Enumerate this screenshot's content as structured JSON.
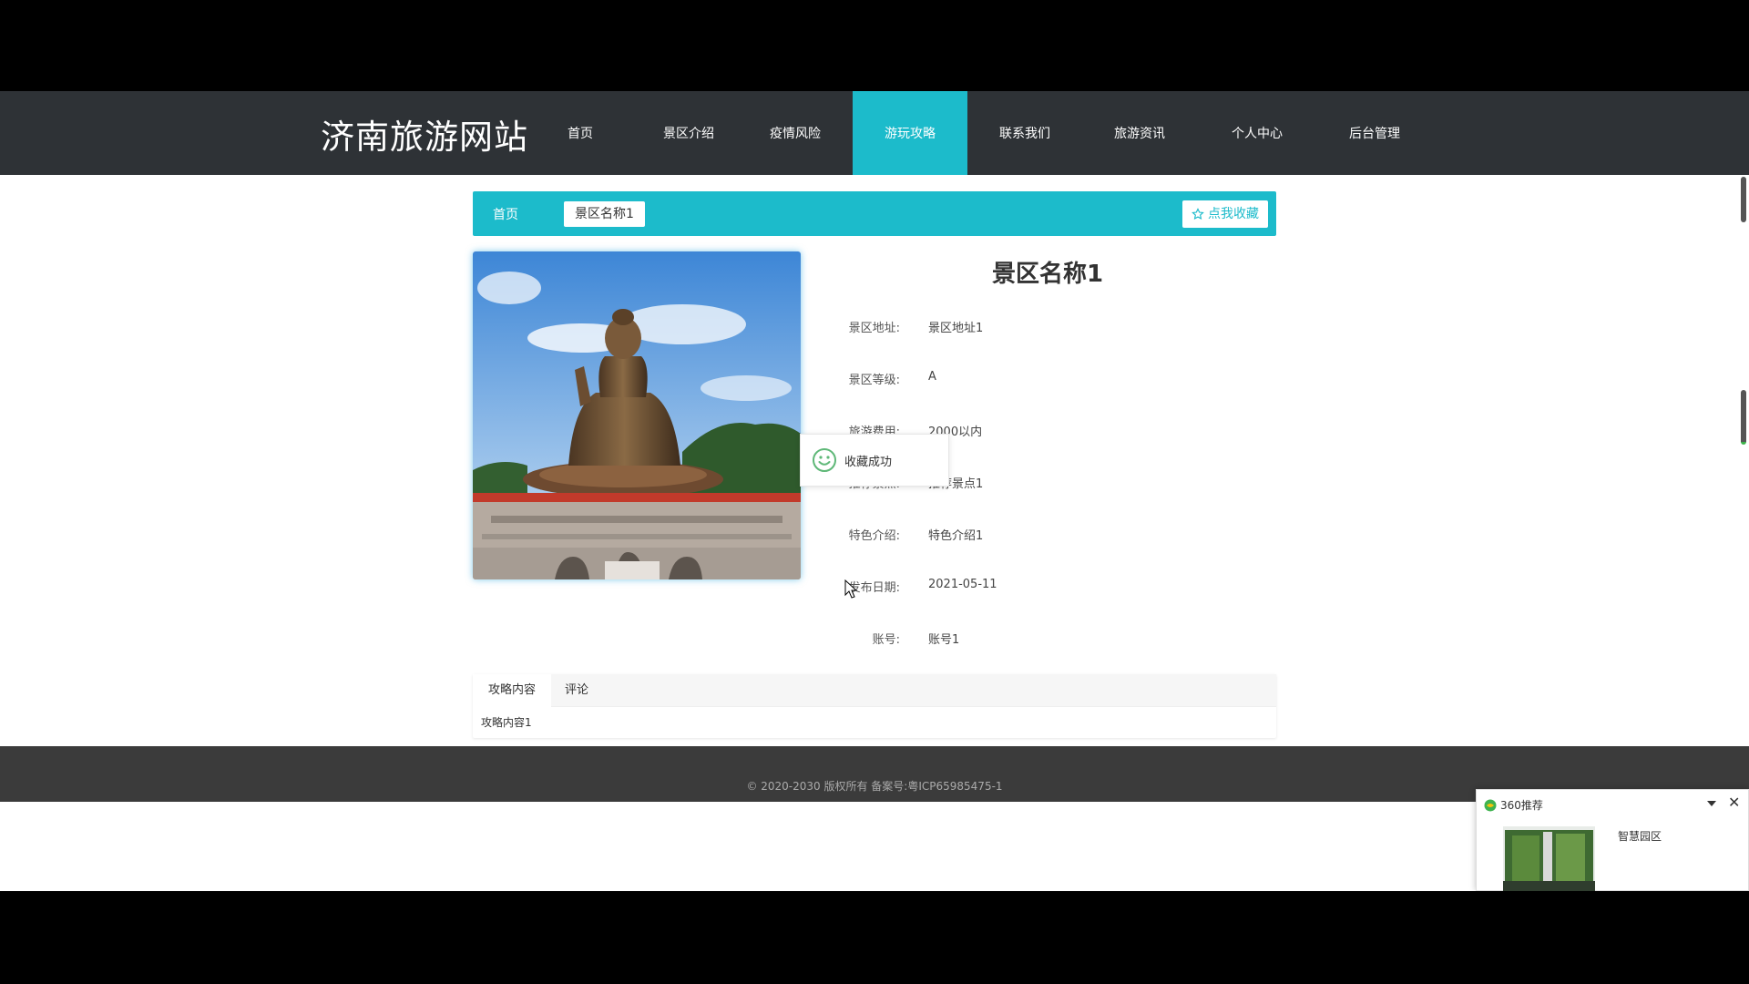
{
  "site": {
    "title": "济南旅游网站"
  },
  "nav": {
    "items": [
      {
        "label": "首页"
      },
      {
        "label": "景区介绍"
      },
      {
        "label": "疫情风险"
      },
      {
        "label": "游玩攻略"
      },
      {
        "label": "联系我们"
      },
      {
        "label": "旅游资讯"
      },
      {
        "label": "个人中心"
      },
      {
        "label": "后台管理"
      }
    ],
    "active_index": 3
  },
  "breadcrumb": {
    "home": "首页",
    "current": "景区名称1",
    "favorite_button": "点我收藏"
  },
  "detail": {
    "title": "景区名称1",
    "fields": [
      {
        "label": "景区地址:",
        "value": "景区地址1"
      },
      {
        "label": "景区等级:",
        "value": "A"
      },
      {
        "label": "旅游费用:",
        "value": "2000以内"
      },
      {
        "label": "推荐景点:",
        "value": "推荐景点1"
      },
      {
        "label": "特色介绍:",
        "value": "特色介绍1"
      },
      {
        "label": "发布日期:",
        "value": "2021-05-11"
      },
      {
        "label": "账号:",
        "value": "账号1"
      }
    ]
  },
  "toast": {
    "message": "收藏成功",
    "icon": "smile-icon"
  },
  "tabs": {
    "items": [
      {
        "label": "攻略内容"
      },
      {
        "label": "评论"
      }
    ],
    "active_index": 0,
    "content": "攻略内容1"
  },
  "footer": {
    "text": "© 2020-2030 版权所有 备案号:粤ICP65985475-1"
  },
  "popup": {
    "title": "360推荐",
    "item_text": "智慧园区"
  },
  "colors": {
    "accent": "#1cbbcb",
    "header_bg": "#2e3236",
    "footer_bg": "#3b3b3b"
  }
}
